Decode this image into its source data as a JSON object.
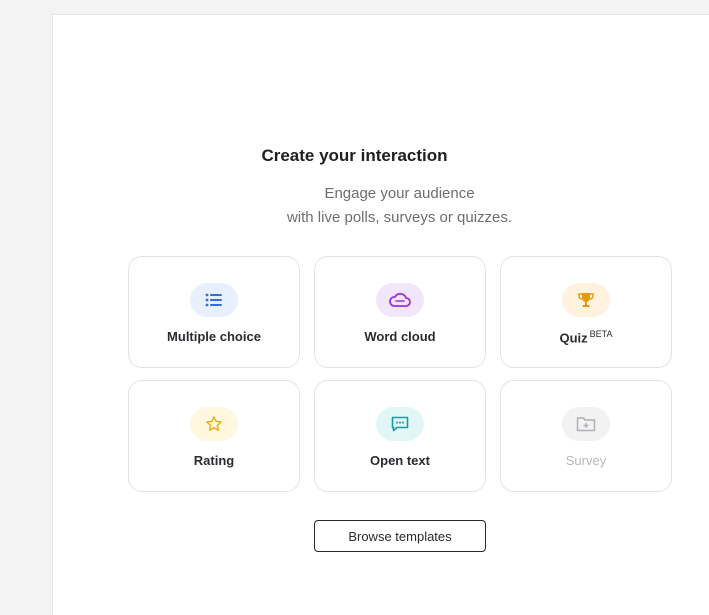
{
  "header": {
    "title": "Create your interaction",
    "subtitle_line1": "Engage your audience",
    "subtitle_line2": "with live polls, surveys or quizzes."
  },
  "cards": [
    {
      "label": "Multiple choice",
      "icon": "list-icon",
      "icon_bg": "#e8f0fe",
      "icon_color": "#2f6fe0"
    },
    {
      "label": "Word cloud",
      "icon": "cloud-icon",
      "icon_bg": "#f1e6fb",
      "icon_color": "#9b32d6"
    },
    {
      "label": "Quiz",
      "badge": "BETA",
      "icon": "trophy-icon",
      "icon_bg": "#fff3e0",
      "icon_color": "#e69a12"
    },
    {
      "label": "Rating",
      "icon": "star-icon",
      "icon_bg": "#fff8df",
      "icon_color": "#e6ad0e"
    },
    {
      "label": "Open text",
      "icon": "chat-icon",
      "icon_bg": "#e3f6f7",
      "icon_color": "#1a9aa6"
    },
    {
      "label": "Survey",
      "icon": "folder-plus-icon",
      "icon_bg": "#f2f2f3",
      "icon_color": "#b0b0b5",
      "disabled": true
    }
  ],
  "browse_label": "Browse templates"
}
